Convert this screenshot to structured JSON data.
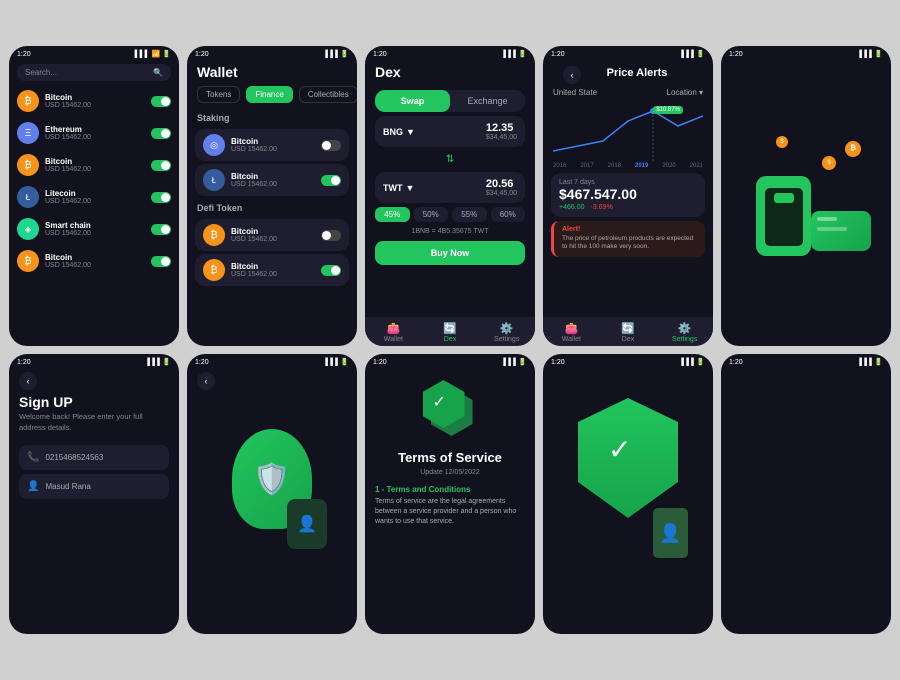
{
  "phones": {
    "p1": {
      "time": "1:20",
      "search_placeholder": "Search...",
      "tokens": [
        {
          "name": "Bitcoin",
          "usd": "USD 15462.00",
          "icon": "₿",
          "color": "btc",
          "on": true
        },
        {
          "name": "Ethereum",
          "usd": "USD 15462.00",
          "icon": "Ξ",
          "color": "eth",
          "on": true
        },
        {
          "name": "Bitcoin",
          "usd": "USD 15462.00",
          "icon": "₿",
          "color": "btc",
          "on": true
        },
        {
          "name": "Litecoin",
          "usd": "USD 15462.00",
          "icon": "Ł",
          "color": "ltc",
          "on": true
        },
        {
          "name": "Smart chain",
          "usd": "USD 15462.00",
          "icon": "◈",
          "color": "sc",
          "on": true
        },
        {
          "name": "Bitcoin",
          "usd": "USD 15462.00",
          "icon": "₿",
          "color": "btc",
          "on": true
        }
      ]
    },
    "p2": {
      "time": "1:20",
      "title": "Wallet",
      "tabs": [
        "Tokens",
        "Finance",
        "Collectibles"
      ],
      "active_tab": "Finance",
      "staking_title": "Staking",
      "staking": [
        {
          "name": "Bitcoin",
          "usd": "USD 15462.00",
          "icon": "₿",
          "on": false
        },
        {
          "name": "Bitcoin",
          "usd": "USD 15462.00",
          "icon": "Ł",
          "on": true
        }
      ],
      "defi_title": "Defi Token",
      "defi": [
        {
          "name": "Bitcoin",
          "usd": "USD 15462.00",
          "icon": "₿",
          "on": false
        },
        {
          "name": "Bitcoin",
          "usd": "USD 15462.00",
          "icon": "₿",
          "on": true
        }
      ]
    },
    "p3": {
      "time": "1:20",
      "title": "Dex",
      "swap_label": "Swap",
      "exchange_label": "Exchange",
      "from_token": "BNG",
      "from_amount": "12.35",
      "from_usd": "$34,45,00",
      "to_token": "TWT",
      "to_amount": "20.56",
      "to_usd": "$34,45,00",
      "percents": [
        "45%",
        "50%",
        "55%",
        "60%"
      ],
      "conversion": "1BNB = 4B5.35675 TWT",
      "buy_label": "Buy Now",
      "nav": [
        "Wallet",
        "Dex",
        "Settings"
      ]
    },
    "p4": {
      "time": "1:20",
      "title": "Price Alerts",
      "location": "United State",
      "location_label": "Location",
      "chart_tooltip": "$10.87%",
      "years": [
        "2016",
        "2017",
        "2018",
        "2019",
        "2020",
        "2021"
      ],
      "period": "Last 7 days",
      "value": "$467.547.00",
      "change_pos": "+466.00",
      "change_neg": "-3.69%",
      "alert_title": "Alert!",
      "alert_text": "The price of petroleum products are expected to hit the 100 make very soon.",
      "nav": [
        "Wallet",
        "Dex",
        "Settings"
      ]
    },
    "p5": {
      "time": "1:20"
    },
    "p6": {
      "time": "1:20",
      "title": "Sign UP",
      "subtitle": "Welcome back! Please enter your full address details.",
      "phone_placeholder": "0215468524563",
      "name_placeholder": "Masud Rana"
    },
    "p8": {
      "time": "1:20",
      "title": "Terms of Service",
      "date": "Update 12/05/2022",
      "section1_title": "1 - Terms and Conditions",
      "section1_text": "Terms of service are the legal agreements between a service provider and a person who wants to use that service."
    },
    "p9": {
      "time": "1:20"
    }
  }
}
